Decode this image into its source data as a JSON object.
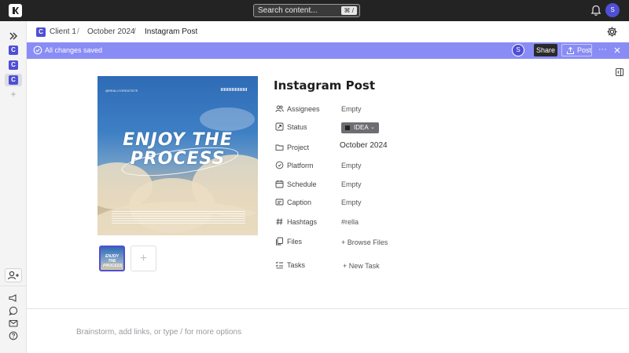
{
  "topbar": {
    "search_placeholder": "Search content...",
    "search_shortcut": "⌘ /",
    "avatar_initial": "S"
  },
  "sidebar": {
    "items": [
      {
        "badge": "C"
      },
      {
        "badge": "C"
      },
      {
        "badge": "C",
        "selected": true
      }
    ]
  },
  "breadcrumb": {
    "badge": "C",
    "items": [
      "Client 1",
      "October 2024",
      "Instagram Post"
    ],
    "separator": "/"
  },
  "banner": {
    "saved_text": "All changes saved",
    "avatar_initial": "S",
    "share_label": "Share",
    "post_label": "Post",
    "more_label": "···",
    "accent_color": "#8a8cf5"
  },
  "cover": {
    "handle": "@REALLYGREATSITE",
    "headline_line1": "ENJOY THE",
    "headline_line2": "PROCESS",
    "thumb_text": "ENJOY THE PROCESS"
  },
  "post": {
    "title": "Instagram Post",
    "properties": [
      {
        "label": "Assignees",
        "value": "Empty",
        "icon": "users-icon"
      },
      {
        "label": "Status",
        "value": "IDEA",
        "icon": "status-icon"
      },
      {
        "label": "Project",
        "value": "October 2024",
        "icon": "folder-icon"
      },
      {
        "label": "Platform",
        "value": "Empty",
        "icon": "platform-icon"
      },
      {
        "label": "Schedule",
        "value": "Empty",
        "icon": "calendar-icon"
      },
      {
        "label": "Caption",
        "value": "Empty",
        "icon": "caption-icon"
      },
      {
        "label": "Hashtags",
        "value": "#rella",
        "icon": "hash-icon"
      },
      {
        "label": "Files",
        "value": "+ Browse Files",
        "icon": "files-icon"
      },
      {
        "label": "Tasks",
        "value": "+ New Task",
        "icon": "tasks-icon"
      }
    ]
  },
  "editor": {
    "placeholder": "Brainstorm, add links, or type / for more options"
  }
}
